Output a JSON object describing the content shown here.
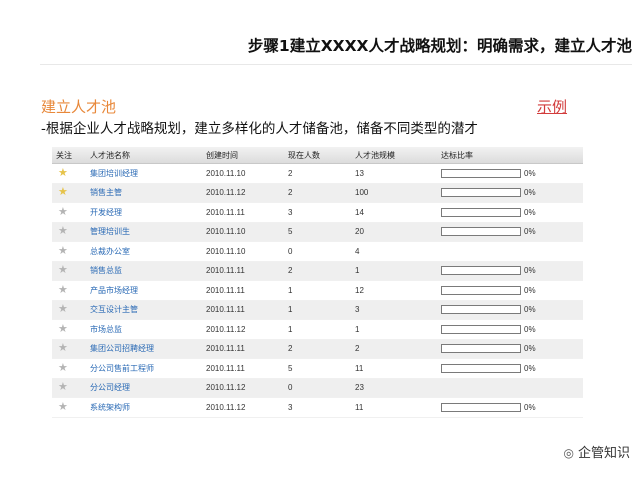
{
  "header": {
    "title": "步骤1建立XXXX人才战略规划：明确需求，建立人才池"
  },
  "section": {
    "title": "建立人才池",
    "example_link": "示例",
    "subtitle": "-根据企业人才战略规划，建立多样化的人才储备池，储备不同类型的潜才"
  },
  "table": {
    "headers": [
      "关注",
      "人才池名称",
      "创建时间",
      "现在人数",
      "人才池规模",
      "达标比率"
    ],
    "rows": [
      {
        "starred": true,
        "name": "集团培训经理",
        "date": "2010.11.10",
        "count": "2",
        "size": "13",
        "progress": 0,
        "pct": "0%"
      },
      {
        "starred": true,
        "name": "销售主管",
        "date": "2010.11.12",
        "count": "2",
        "size": "100",
        "progress": 0,
        "pct": "0%"
      },
      {
        "starred": false,
        "name": "开发经理",
        "date": "2010.11.11",
        "count": "3",
        "size": "14",
        "progress": 0,
        "pct": "0%"
      },
      {
        "starred": false,
        "name": "管理培训生",
        "date": "2010.11.10",
        "count": "5",
        "size": "20",
        "progress": 0,
        "pct": "0%"
      },
      {
        "starred": false,
        "name": "总裁办公室",
        "date": "2010.11.10",
        "count": "0",
        "size": "4",
        "progress": null,
        "pct": ""
      },
      {
        "starred": false,
        "name": "销售总监",
        "date": "2010.11.11",
        "count": "2",
        "size": "1",
        "progress": 0,
        "pct": "0%"
      },
      {
        "starred": false,
        "name": "产品市场经理",
        "date": "2010.11.11",
        "count": "1",
        "size": "12",
        "progress": 0,
        "pct": "0%"
      },
      {
        "starred": false,
        "name": "交互设计主管",
        "date": "2010.11.11",
        "count": "1",
        "size": "3",
        "progress": 0,
        "pct": "0%"
      },
      {
        "starred": false,
        "name": "市场总监",
        "date": "2010.11.12",
        "count": "1",
        "size": "1",
        "progress": 0,
        "pct": "0%"
      },
      {
        "starred": false,
        "name": "集团公司招聘经理",
        "date": "2010.11.11",
        "count": "2",
        "size": "2",
        "progress": 0,
        "pct": "0%"
      },
      {
        "starred": false,
        "name": "分公司售前工程师",
        "date": "2010.11.11",
        "count": "5",
        "size": "11",
        "progress": 0,
        "pct": "0%"
      },
      {
        "starred": false,
        "name": "分公司经理",
        "date": "2010.11.12",
        "count": "0",
        "size": "23",
        "progress": null,
        "pct": ""
      },
      {
        "starred": false,
        "name": "系统架构师",
        "date": "2010.11.12",
        "count": "3",
        "size": "11",
        "progress": 0,
        "pct": "0%"
      }
    ]
  },
  "watermark": {
    "icon": "wechat-icon",
    "text": "企管知识"
  },
  "colors": {
    "section_title": "#e8883a",
    "example_link": "#d23b3b",
    "star_on": "#e6c34a",
    "star_off": "#b4b4b4",
    "name_link": "#2a6ab5"
  }
}
